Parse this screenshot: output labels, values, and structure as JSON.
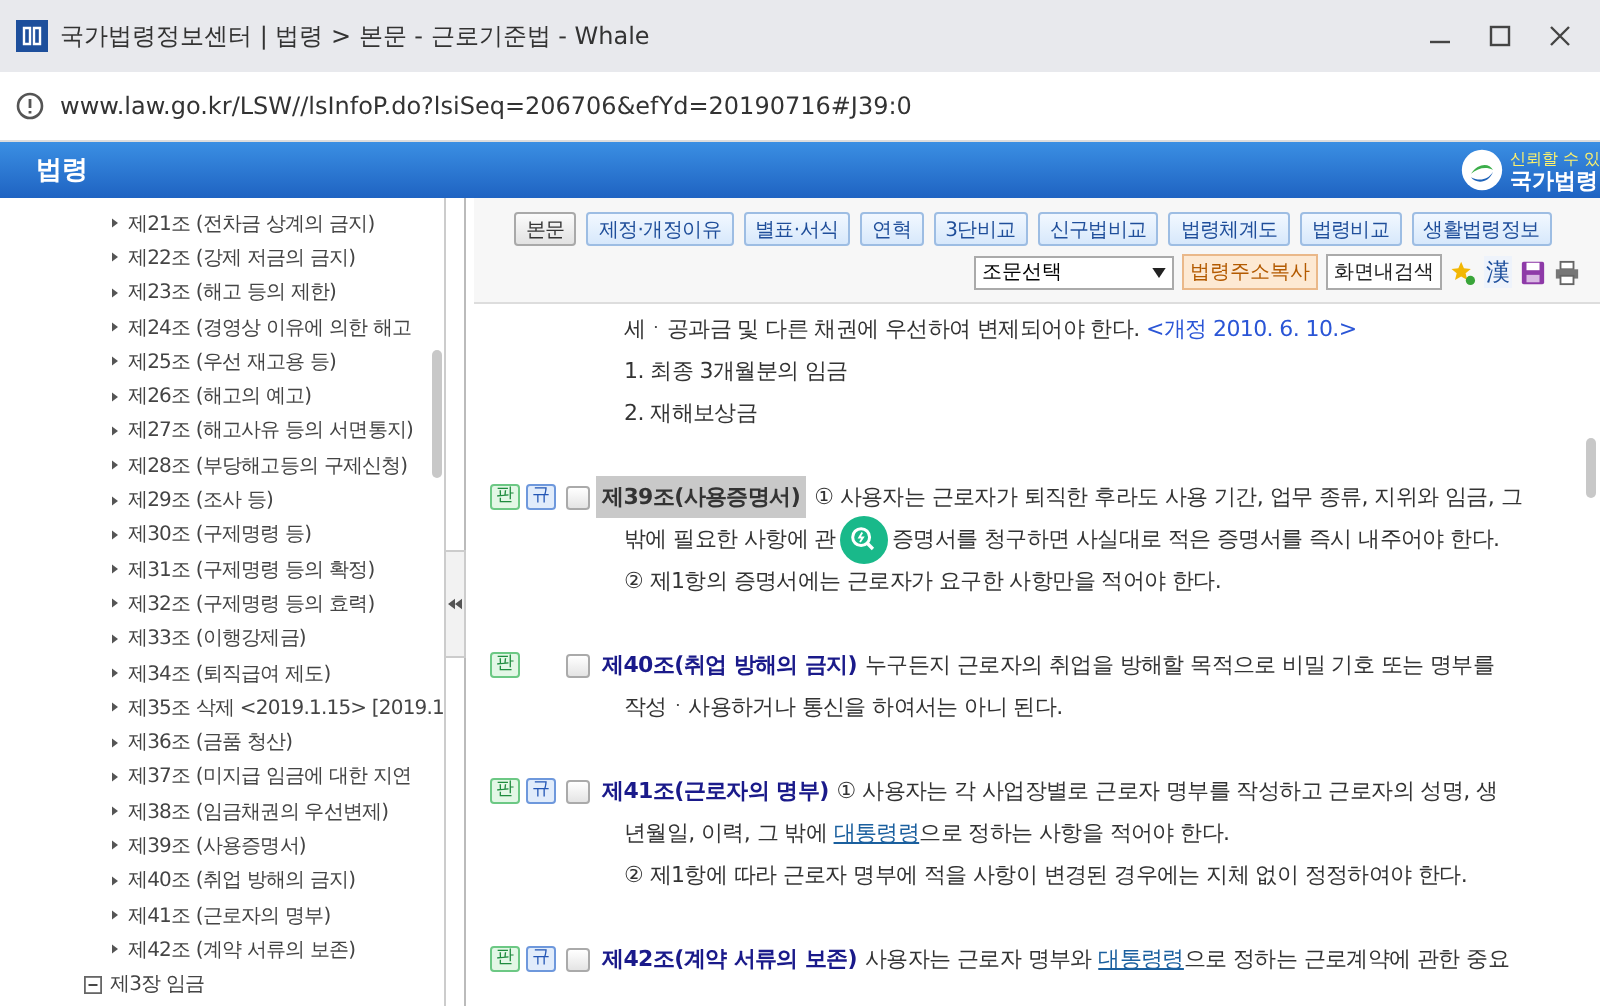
{
  "window": {
    "title": "국가법령정보센터 | 법령 > 본문 - 근로기준법 - Whale",
    "address": "www.law.go.kr/LSW//lsInfoP.do?lsiSeq=206706&efYd=20190716#J39:0"
  },
  "header": {
    "title": "법령",
    "logo_tagline": "신뢰할 수 있",
    "logo_name": "국가법령"
  },
  "sidebar": {
    "items": [
      {
        "label": "제21조 (전차금 상계의 금지)"
      },
      {
        "label": "제22조 (강제 저금의 금지)"
      },
      {
        "label": "제23조 (해고 등의 제한)"
      },
      {
        "label": "제24조 (경영상 이유에 의한 해고"
      },
      {
        "label": "제25조 (우선 재고용 등)"
      },
      {
        "label": "제26조 (해고의 예고)"
      },
      {
        "label": "제27조 (해고사유 등의 서면통지)"
      },
      {
        "label": "제28조 (부당해고등의 구제신청)"
      },
      {
        "label": "제29조 (조사 등)"
      },
      {
        "label": "제30조 (구제명령 등)"
      },
      {
        "label": "제31조 (구제명령 등의 확정)"
      },
      {
        "label": "제32조 (구제명령 등의 효력)"
      },
      {
        "label": "제33조 (이행강제금)"
      },
      {
        "label": "제34조 (퇴직급여 제도)"
      },
      {
        "label": "제35조 삭제 <2019.1.15> [2019.1"
      },
      {
        "label": "제36조 (금품 청산)"
      },
      {
        "label": "제37조 (미지급 임금에 대한 지연"
      },
      {
        "label": "제38조 (임금채권의 우선변제)"
      },
      {
        "label": "제39조 (사용증명서)"
      },
      {
        "label": "제40조 (취업 방해의 금지)"
      },
      {
        "label": "제41조 (근로자의 명부)"
      },
      {
        "label": "제42조 (계약 서류의 보존)"
      }
    ],
    "next_chapter": {
      "label": "제3장 임금",
      "expanded": true
    }
  },
  "toolbar": {
    "tabs": [
      {
        "label": "본문",
        "selected": true
      },
      {
        "label": "제정·개정이유",
        "selected": false
      },
      {
        "label": "별표·서식",
        "selected": false
      },
      {
        "label": "연혁",
        "selected": false
      },
      {
        "label": "3단비교",
        "selected": false
      },
      {
        "label": "신구법비교",
        "selected": false
      },
      {
        "label": "법령체계도",
        "selected": false
      },
      {
        "label": "법령비교",
        "selected": false
      },
      {
        "label": "생활법령정보",
        "selected": false
      }
    ],
    "article_select": "조문선택",
    "copy_button": "법령주소복사",
    "search_button": "화면내검색",
    "hanja_button": "漢"
  },
  "content": {
    "lead_lines": [
      [
        {
          "kind": "text",
          "text": "세ㆍ공과금 및 다른 채권에 우선하여 변제되어야 한다. "
        },
        {
          "kind": "note",
          "text": "<개정 2010. 6. 10.>"
        }
      ],
      [
        {
          "kind": "text",
          "text": "1. 최종 3개월분의 임금"
        }
      ],
      [
        {
          "kind": "text",
          "text": "2. 재해보상금"
        }
      ]
    ],
    "articles": [
      {
        "badges": [
          {
            "kind": "precedent",
            "text": "판"
          },
          {
            "kind": "rule",
            "text": "규"
          }
        ],
        "checked": false,
        "highlighted": true,
        "title": "제39조(사용증명서)",
        "lines": [
          [
            {
              "kind": "text",
              "text": "① 사용자는 근로자가 퇴직한 후라도 사용 기간, 업무 종류, 지위와 임금, 그"
            }
          ],
          [
            {
              "kind": "text",
              "text": "밖에 필요한 사항에 관"
            },
            {
              "kind": "floating_button"
            },
            {
              "kind": "text",
              "text": "증명서를 청구하면 사실대로 적은 증명서를 즉시 내주어야 한다."
            }
          ],
          [
            {
              "kind": "text",
              "text": "② 제1항의 증명서에는 근로자가 요구한 사항만을 적어야 한다."
            }
          ]
        ]
      },
      {
        "badges": [
          {
            "kind": "precedent",
            "text": "판"
          }
        ],
        "checked": false,
        "highlighted": false,
        "title": "제40조(취업 방해의 금지)",
        "lines": [
          [
            {
              "kind": "text",
              "text": "누구든지 근로자의 취업을 방해할 목적으로 비밀 기호 또는 명부를"
            }
          ],
          [
            {
              "kind": "text",
              "text": "작성ㆍ사용하거나 통신을 하여서는 아니 된다."
            }
          ]
        ]
      },
      {
        "badges": [
          {
            "kind": "precedent",
            "text": "판"
          },
          {
            "kind": "rule",
            "text": "규"
          }
        ],
        "checked": false,
        "highlighted": false,
        "title": "제41조(근로자의 명부)",
        "lines": [
          [
            {
              "kind": "text",
              "text": "① 사용자는 각 사업장별로 근로자 명부를 작성하고 근로자의 성명, 생"
            }
          ],
          [
            {
              "kind": "text",
              "text": "년월일, 이력, 그 밖에 "
            },
            {
              "kind": "link",
              "text": "대통령령"
            },
            {
              "kind": "text",
              "text": "으로 정하는 사항을 적어야 한다."
            }
          ],
          [
            {
              "kind": "text",
              "text": "② 제1항에 따라 근로자 명부에 적을 사항이 변경된 경우에는 지체 없이 정정하여야 한다."
            }
          ]
        ]
      },
      {
        "badges": [
          {
            "kind": "precedent",
            "text": "판"
          },
          {
            "kind": "rule",
            "text": "규"
          }
        ],
        "checked": false,
        "highlighted": false,
        "title": "제42조(계약 서류의 보존)",
        "lines": [
          [
            {
              "kind": "text",
              "text": "사용자는 근로자 명부와 "
            },
            {
              "kind": "link",
              "text": "대통령령"
            },
            {
              "kind": "text",
              "text": "으로 정하는 근로계약에 관한 중요"
            }
          ]
        ]
      }
    ]
  }
}
